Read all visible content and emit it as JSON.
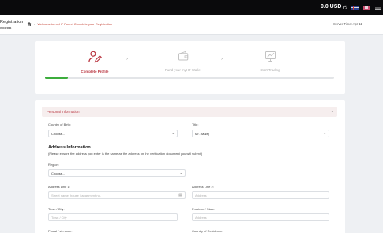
{
  "topbar": {
    "balance": "0.0 USD",
    "icons": [
      "refresh-icon",
      "flag-icon",
      "flag-icon",
      "menu-icon"
    ]
  },
  "header": {
    "side_title_line1": "Registration",
    "side_title_line2": "ocess",
    "breadcrumb_sep": "›",
    "breadcrumb_welcome": "Welcome to myHF Forex! Complete your Registration",
    "server_time": "Server Time: Apr 11"
  },
  "steps": [
    {
      "label": "Complete Profile",
      "icon": "user-edit-icon",
      "active": true
    },
    {
      "label": "Fund your myHF Wallet",
      "icon": "wallet-icon",
      "active": false
    },
    {
      "label": "Start Trading",
      "icon": "chart-icon",
      "active": false
    }
  ],
  "progress": {
    "fraction": 0.08,
    "color": "#3cad3c"
  },
  "form": {
    "section_title": "Personal Information",
    "country_of_birth_label": "Country of Birth:",
    "country_of_birth_value": "Choose...",
    "title_label": "Title:",
    "title_value": "Mr. (Male)",
    "address_title": "Address Information",
    "address_note": "(Please ensure the address you enter is the same as the address on the verification document you will submit)",
    "region_label": "Region:",
    "region_value": "Choose...",
    "address1_label": "Address Line 1:",
    "address1_placeholder": "Street name, house / apartment no.",
    "address2_label": "Address Line 2:",
    "address2_placeholder": "Address",
    "town_label": "Town / City:",
    "town_placeholder": "Town / City",
    "province_label": "Province / State:",
    "province_placeholder": "Address",
    "postal_label": "Postal / zip code:",
    "residence_label": "Country of Residence:"
  },
  "colors": {
    "accent": "#b8333e",
    "topbar": "#0a0a0c",
    "progress": "#3cad3c"
  }
}
